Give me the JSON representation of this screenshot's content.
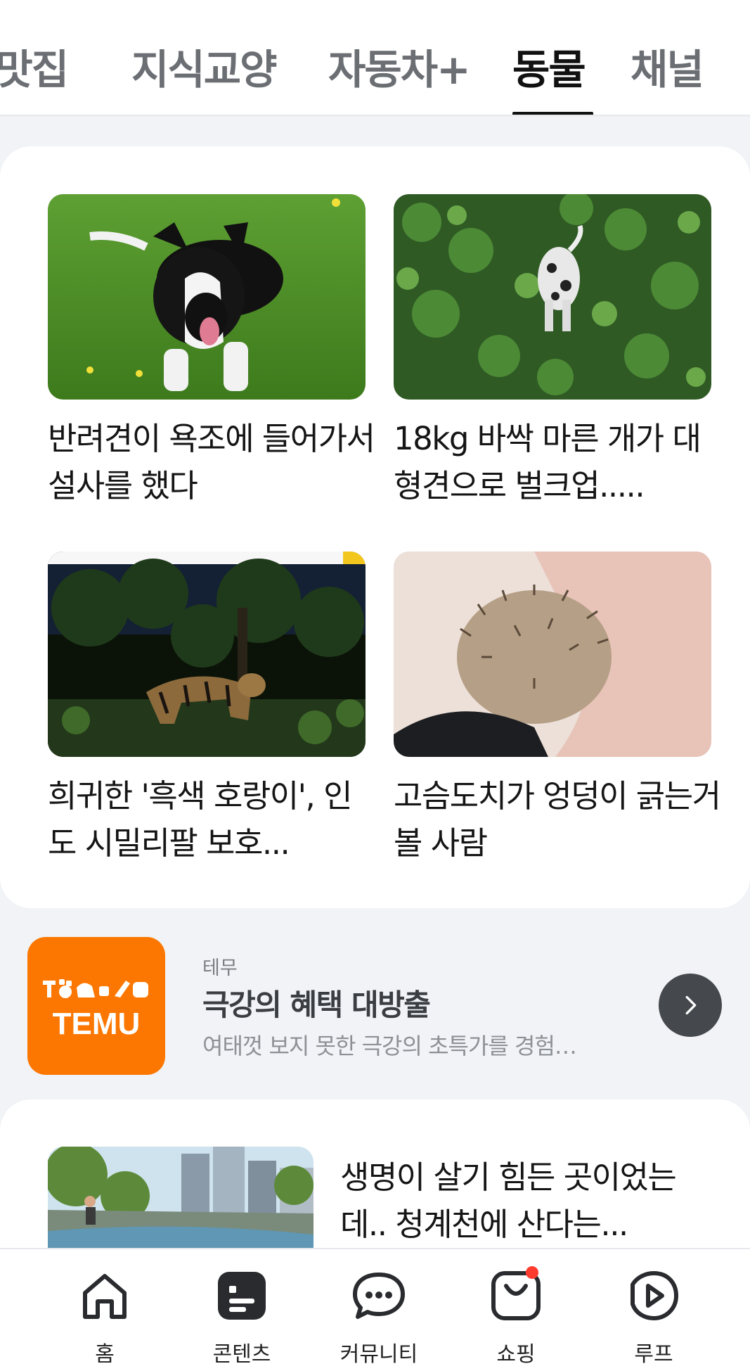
{
  "tabs": [
    {
      "label": "맛집",
      "active": false
    },
    {
      "label": "지식교양",
      "active": false
    },
    {
      "label": "자동차+",
      "active": false
    },
    {
      "label": "동물",
      "active": true
    },
    {
      "label": "채널",
      "active": false
    }
  ],
  "feed": [
    {
      "title": "반려견이 욕조에 들어가서 설사를 했다",
      "image": "border collie lying on grass"
    },
    {
      "title": "18kg 바싹 마른 개가 대형견으로 벌크업.....",
      "image": "spotted dog walking in tall green weeds"
    },
    {
      "title": "희귀한 '흑색 호랑이', 인도 시밀리팔 보호...",
      "image": "tiger in a dark forest at night (website screenshot)"
    },
    {
      "title": "고슴도치가 엉덩이 긁는거 볼 사람",
      "image": "hedgehog being scratched"
    }
  ],
  "ad": {
    "brand": "테무",
    "title": "극강의 혜택 대방출",
    "description": "여태껏 보지 못한 극강의 초특가를 경험…",
    "logo_text": "TEMU",
    "logo_color": "#fb7701",
    "arrow_icon": "chevron-right-icon"
  },
  "feed2": {
    "title": "생명이 살기 힘든 곳이었는데.. 청계천에 산다는...",
    "image": "stream in a city with high-rise buildings"
  },
  "bottom_nav": [
    {
      "label": "홈",
      "icon": "home-icon"
    },
    {
      "label": "콘텐츠",
      "icon": "content-icon"
    },
    {
      "label": "커뮤니티",
      "icon": "chat-bubble-icon"
    },
    {
      "label": "쇼핑",
      "icon": "shopping-bag-icon",
      "badge": true
    },
    {
      "label": "루프",
      "icon": "play-loop-icon"
    }
  ],
  "colors": {
    "accent": "#111111",
    "badge": "#ff3b30",
    "ad_logo": "#fb7701"
  }
}
